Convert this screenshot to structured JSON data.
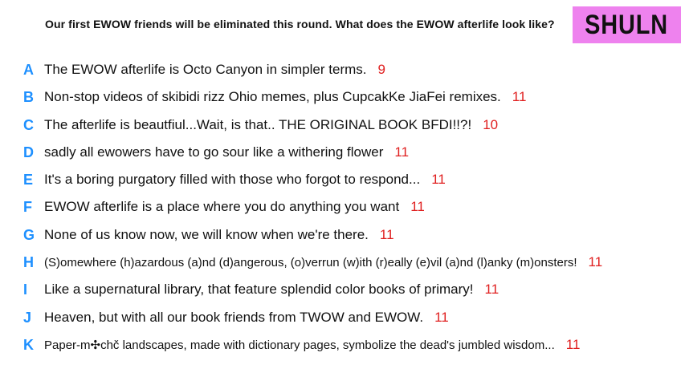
{
  "prompt": "Our first EWOW friends will be eliminated this round. What does the EWOW afterlife look like?",
  "code": "SHULN",
  "colors": {
    "letter": "#1e90ff",
    "count": "#e02020",
    "code_box": "#ee82ee",
    "text": "#111111"
  },
  "responses": [
    {
      "letter": "A",
      "text": "The EWOW afterlife is Octo Canyon in simpler terms.",
      "count": "9"
    },
    {
      "letter": "B",
      "text": "Non-stop videos of skibidi rizz Ohio memes, plus CupcakKe JiaFei remixes.",
      "count": "11"
    },
    {
      "letter": "C",
      "text": "The afterlife is beautfiul...Wait, is that.. THE ORIGINAL BOOK BFDI!!?!",
      "count": "10"
    },
    {
      "letter": "D",
      "text": "sadly all ewowers have to go sour like a withering flower",
      "count": "11"
    },
    {
      "letter": "E",
      "text": "It's a boring purgatory filled with those who forgot to respond...",
      "count": "11"
    },
    {
      "letter": "F",
      "text": "EWOW afterlife is a place where you do anything you want",
      "count": "11"
    },
    {
      "letter": "G",
      "text": "None of us know now, we will know when we're there.",
      "count": "11"
    },
    {
      "letter": "H",
      "text": "(S)omewhere (h)azardous (a)nd (d)angerous, (o)verrun (w)ith (r)eally (e)vil (a)nd (l)anky (m)onsters!",
      "count": "11"
    },
    {
      "letter": "I",
      "text": "Like a supernatural library, that feature splendid color books of primary!",
      "count": "11"
    },
    {
      "letter": "J",
      "text": "Heaven, but with all our book friends from TWOW and EWOW.",
      "count": "11"
    },
    {
      "letter": "K",
      "text": "Paper-m✣chč landscapes, made with dictionary pages, symbolize the dead's jumbled wisdom...",
      "count": "11"
    }
  ]
}
